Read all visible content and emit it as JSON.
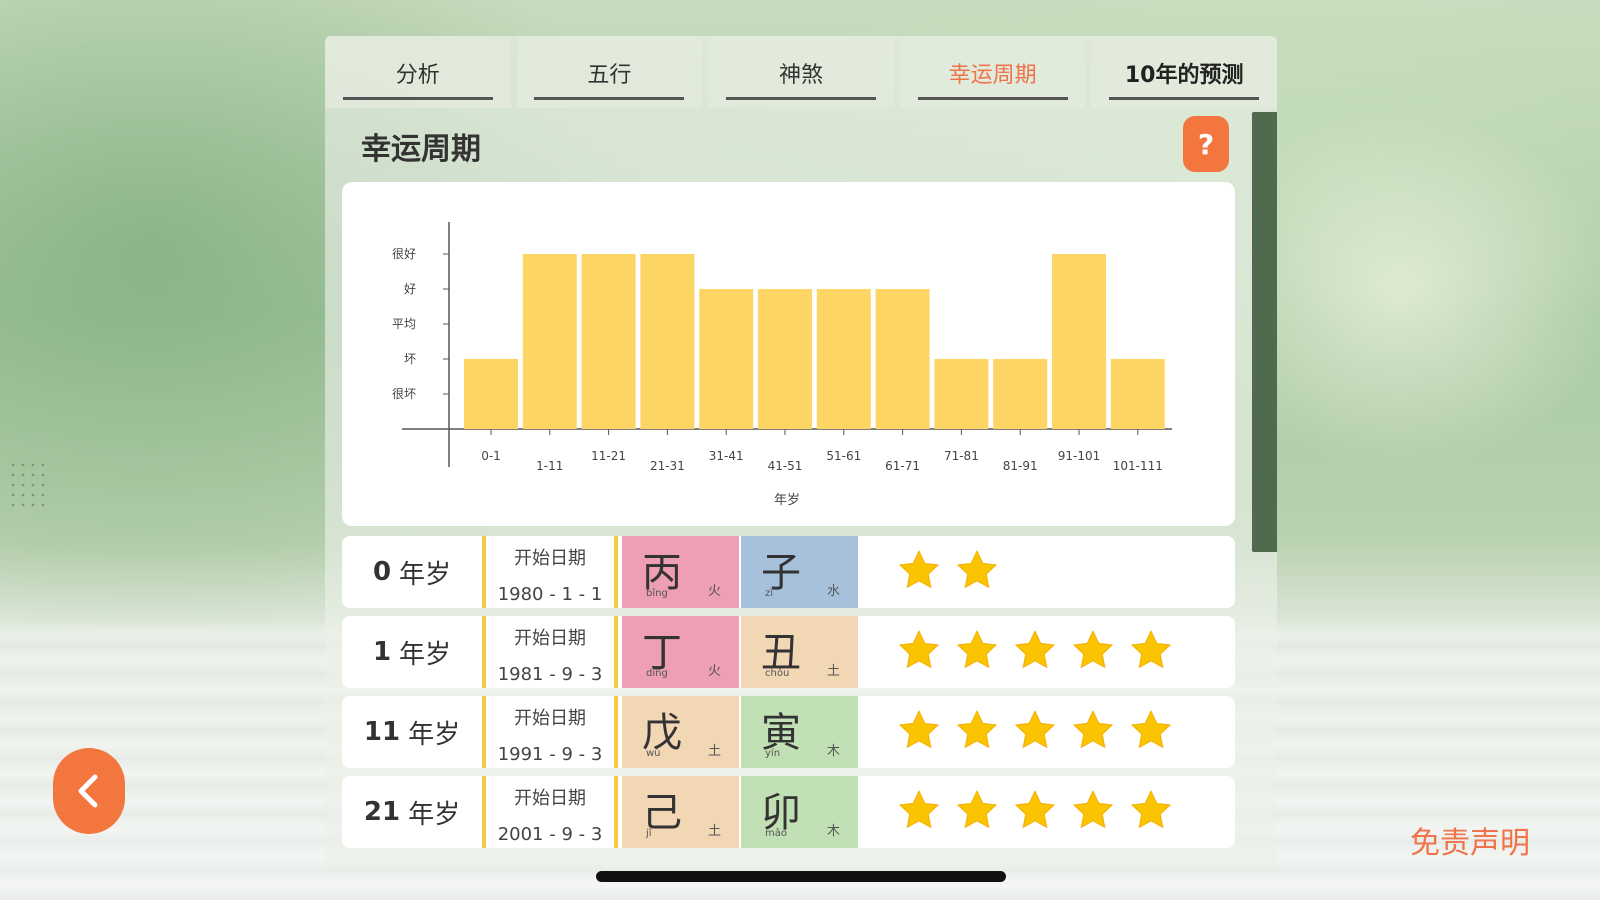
{
  "tabs": [
    {
      "label": "分析",
      "active": false
    },
    {
      "label": "五行",
      "active": false
    },
    {
      "label": "神煞",
      "active": false
    },
    {
      "label": "幸运周期",
      "active": true
    },
    {
      "label": "10年的预测",
      "active": false
    }
  ],
  "section_title": "幸运周期",
  "help_label": "?",
  "colors": {
    "accent": "#f3763f",
    "bar": "#fdd565",
    "fire": "#ee9fb5",
    "water": "#a7c1dc",
    "earth": "#f1d7b3",
    "wood": "#c2e0b5"
  },
  "chart_data": {
    "type": "bar",
    "xlabel": "年岁",
    "ylabel": "",
    "y_levels": [
      "很坏",
      "坏",
      "平均",
      "好",
      "很好"
    ],
    "categories": [
      "0-1",
      "1-11",
      "11-21",
      "21-31",
      "31-41",
      "41-51",
      "51-61",
      "61-71",
      "71-81",
      "81-91",
      "91-101",
      "101-111"
    ],
    "values": [
      2,
      5,
      5,
      5,
      4,
      4,
      4,
      4,
      2,
      2,
      5,
      2
    ],
    "ylim": [
      0,
      5
    ]
  },
  "periods": [
    {
      "age": "0",
      "age_unit": "年岁",
      "date_label": "开始日期",
      "date": "1980 - 1 - 1",
      "stem": {
        "char": "丙",
        "pinyin": "bǐng",
        "element": "火",
        "color": "#ee9fb5"
      },
      "branch": {
        "char": "子",
        "pinyin": "zǐ",
        "element": "水",
        "color": "#a7c1dc"
      },
      "stars": 2
    },
    {
      "age": "1",
      "age_unit": "年岁",
      "date_label": "开始日期",
      "date": "1981 - 9 - 3",
      "stem": {
        "char": "丁",
        "pinyin": "dīng",
        "element": "火",
        "color": "#ee9fb5"
      },
      "branch": {
        "char": "丑",
        "pinyin": "chǒu",
        "element": "土",
        "color": "#f1d7b3"
      },
      "stars": 5
    },
    {
      "age": "11",
      "age_unit": "年岁",
      "date_label": "开始日期",
      "date": "1991 - 9 - 3",
      "stem": {
        "char": "戊",
        "pinyin": "wù",
        "element": "土",
        "color": "#f1d7b3"
      },
      "branch": {
        "char": "寅",
        "pinyin": "yín",
        "element": "木",
        "color": "#c2e0b5"
      },
      "stars": 5
    },
    {
      "age": "21",
      "age_unit": "年岁",
      "date_label": "开始日期",
      "date": "2001 - 9 - 3",
      "stem": {
        "char": "己",
        "pinyin": "jǐ",
        "element": "土",
        "color": "#f1d7b3"
      },
      "branch": {
        "char": "卯",
        "pinyin": "mǎo",
        "element": "木",
        "color": "#c2e0b5"
      },
      "stars": 5
    }
  ],
  "back_icon": "chevron-left-icon",
  "disclaimer_label": "免责声明"
}
